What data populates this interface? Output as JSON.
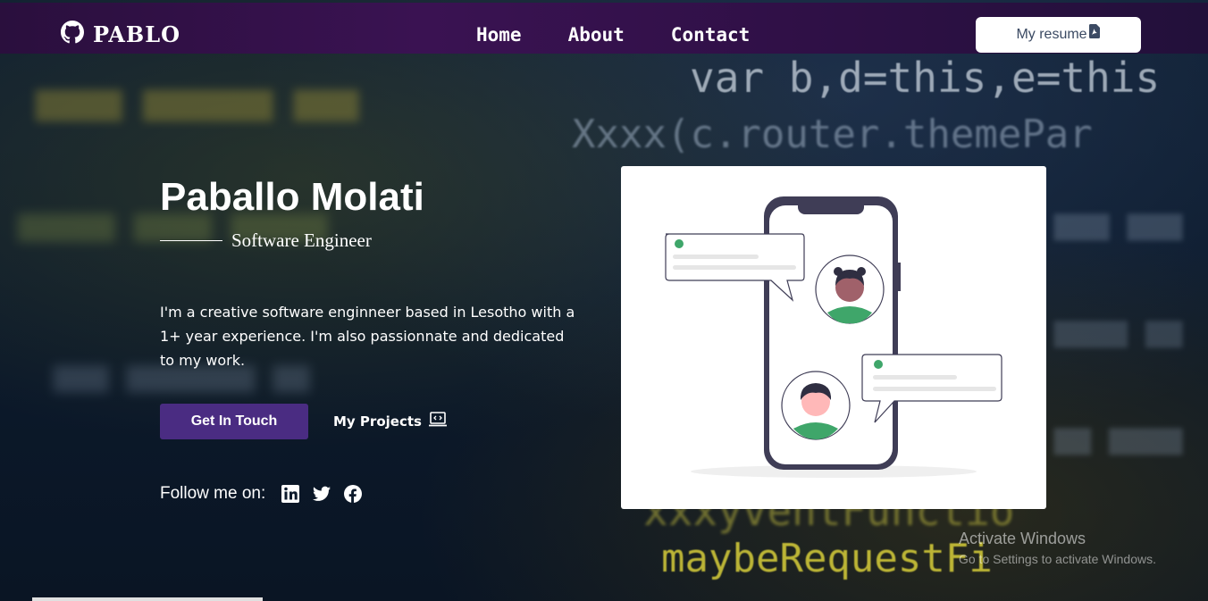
{
  "navbar": {
    "brand": "PABLO",
    "links": [
      "Home",
      "About",
      "Contact"
    ],
    "resume_label": "My resume"
  },
  "hero": {
    "name": "Paballo Molati",
    "role": "Software Engineer",
    "bio": "I'm a creative software enginneer based in Lesotho with a 1+ year experience. I'm also passionnate and dedicated to my work.",
    "cta_primary": "Get In Touch",
    "cta_secondary": "My Projects",
    "follow_label": "Follow me on:",
    "socials": [
      "linkedin-icon",
      "twitter-icon",
      "facebook-icon"
    ]
  },
  "background_code": {
    "line1": "var b,d=this,e=this",
    "line2": "Xxxx(c.router.themePar",
    "line3": "xxxyventFunctio",
    "line4": "maybeRequestFi"
  },
  "watermark": {
    "title": "Activate Windows",
    "subtitle": "Go to Settings to activate Windows."
  },
  "colors": {
    "navbar": "#3a1252",
    "primary_button": "#4a2c82",
    "accent_green": "#3fa66a"
  }
}
